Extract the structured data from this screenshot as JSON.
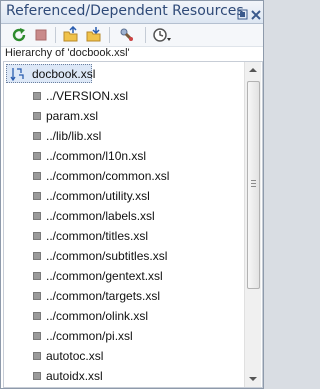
{
  "panel": {
    "title": "Referenced/Dependent Resources",
    "hierarchy_label": "Hierarchy of 'docbook.xsl'"
  },
  "toolbar": {
    "icons": [
      "refresh-icon",
      "stop-icon",
      "open-folder-icon",
      "open-folder-alt-icon",
      "dependencies-icon",
      "history-dropdown-icon"
    ]
  },
  "tree": {
    "root": {
      "label": "docbook.xsl"
    },
    "items": [
      "../VERSION.xsl",
      "param.xsl",
      "../lib/lib.xsl",
      "../common/l10n.xsl",
      "../common/common.xsl",
      "../common/utility.xsl",
      "../common/labels.xsl",
      "../common/titles.xsl",
      "../common/subtitles.xsl",
      "../common/gentext.xsl",
      "../common/targets.xsl",
      "../common/olink.xsl",
      "../common/pi.xsl",
      "autotoc.xsl",
      "autoidx.xsl"
    ]
  },
  "colors": {
    "title": "#2f4a78",
    "selection": "#dde8f7"
  }
}
